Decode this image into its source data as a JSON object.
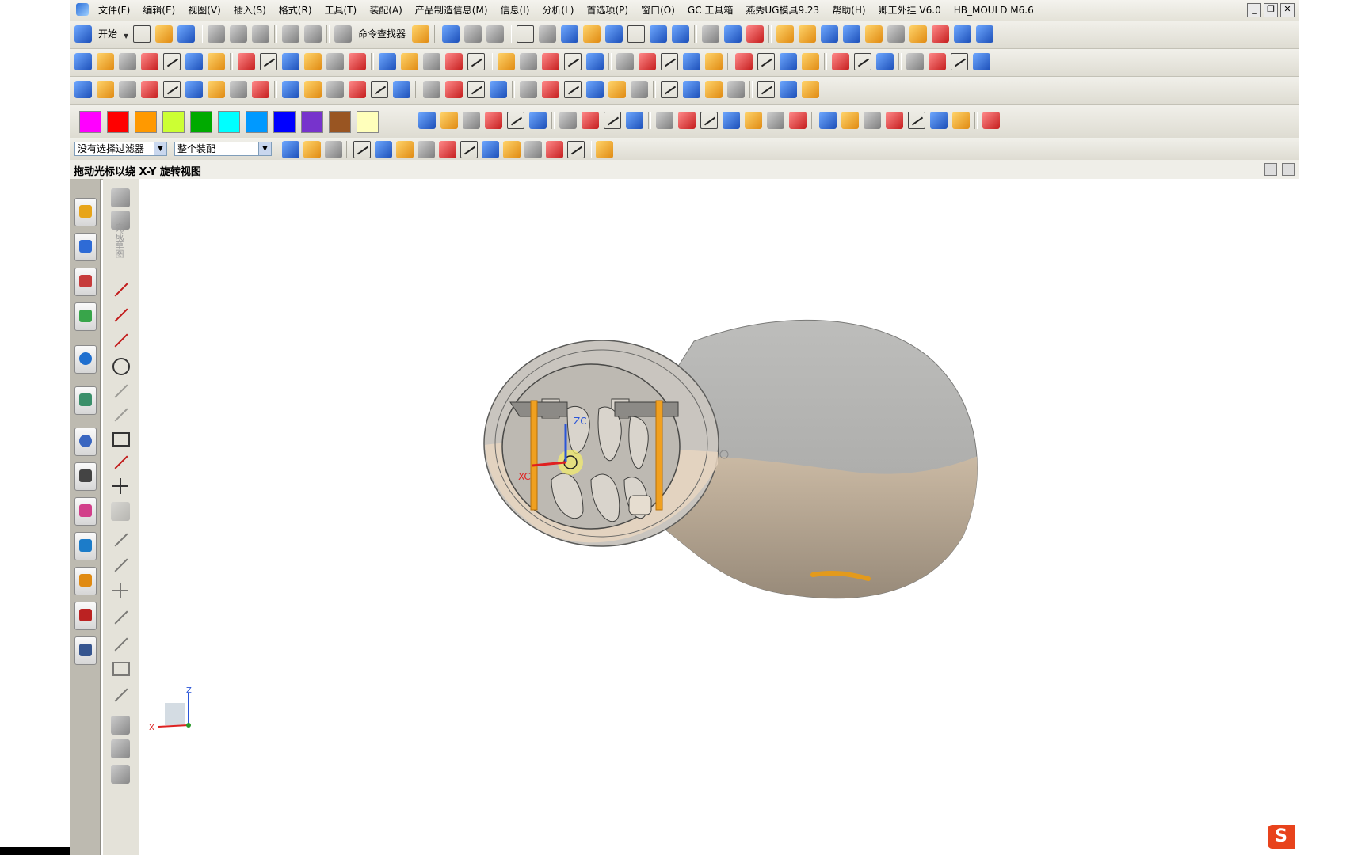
{
  "menubar": {
    "items": [
      "文件(F)",
      "编辑(E)",
      "视图(V)",
      "插入(S)",
      "格式(R)",
      "工具(T)",
      "装配(A)",
      "产品制造信息(M)",
      "信息(I)",
      "分析(L)",
      "首选项(P)",
      "窗口(O)",
      "GC 工具箱",
      "燕秀UG模具9.23",
      "帮助(H)",
      "卿工外挂 V6.0",
      "HB_MOULD M6.6"
    ]
  },
  "window_controls": [
    "_",
    "❐",
    "✕"
  ],
  "toolbar1": {
    "start_label": "开始",
    "command_finder_label": "命令查找器"
  },
  "selection_bar": {
    "filter_value": "没有选择过滤器",
    "scope_value": "整个装配"
  },
  "cue_line": {
    "text": "拖动光标以绕 X-Y 旋转视图"
  },
  "vertical_toolbar": {
    "finish_sketch_label": "完成草图"
  },
  "graphics": {
    "axis_labels": {
      "zc": "ZC",
      "xc": "XC"
    },
    "triad_labels": {
      "x": "X",
      "z": "Z"
    }
  },
  "colors": {
    "swatches": [
      "#ff00ff",
      "#ff0000",
      "#ff9900",
      "#ccff33",
      "#00aa00",
      "#00ffff",
      "#0099ff",
      "#0000ff",
      "#7733cc",
      "#995522",
      "#ffffbb"
    ],
    "model_grey": "#a9a9a7",
    "model_tan": "#c8b6a0",
    "accent_orange": "#f0a020"
  },
  "watermark_letter": "S"
}
